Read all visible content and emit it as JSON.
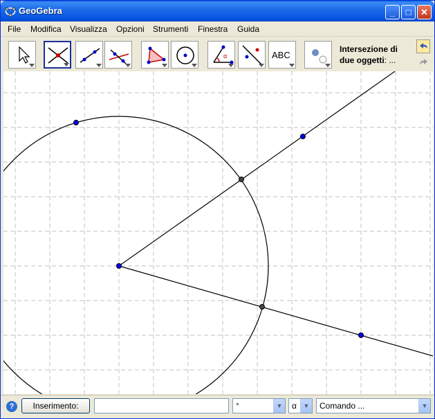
{
  "window": {
    "title": "GeoGebra",
    "controls": {
      "minimize": "_",
      "maximize": "□",
      "close": "✕"
    }
  },
  "menu": [
    "File",
    "Modifica",
    "Visualizza",
    "Opzioni",
    "Strumenti",
    "Finestra",
    "Guida"
  ],
  "toolbar": {
    "tools": [
      {
        "icon": "move-arrow-icon",
        "active": false
      },
      {
        "icon": "intersect-point-icon",
        "active": true
      },
      {
        "icon": "line-through-points-icon",
        "active": false
      },
      {
        "icon": "perpendicular-line-icon",
        "active": false
      },
      {
        "icon": "polygon-icon",
        "active": false
      },
      {
        "icon": "circle-center-point-icon",
        "active": false
      },
      {
        "icon": "angle-icon",
        "active": false
      },
      {
        "icon": "reflect-point-icon",
        "active": false
      },
      {
        "icon": "text-icon",
        "label": "ABC",
        "active": false
      },
      {
        "icon": "show-hide-icon",
        "active": false
      }
    ],
    "tool_info_title": "Intersezione di due oggetti",
    "tool_info_suffix": ": ...",
    "undo_icon": "undo-icon",
    "redo_icon": "redo-icon"
  },
  "input_bar": {
    "help_icon": "help-icon",
    "help_glyph": "?",
    "input_button": "Inserimento:",
    "input_value": "",
    "symbol_combo": "°",
    "greek_combo": "α",
    "command_combo": "Comando ..."
  },
  "colors": {
    "title_blue": "#0554e3",
    "point_blue": "#0000ff",
    "grid": "#c0c0c0",
    "intersection_point": "#444444"
  }
}
